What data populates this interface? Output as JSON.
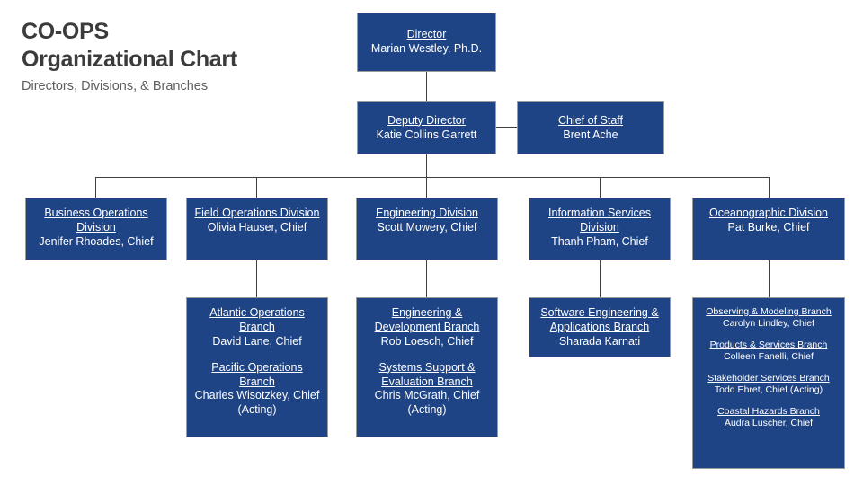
{
  "header": {
    "title_line1": "CO-OPS",
    "title_line2": "Organizational Chart",
    "subtitle": "Directors, Divisions, & Branches"
  },
  "colors": {
    "node_fill": "#1f4485",
    "node_border": "#9a9a9a",
    "node_text": "#ffffff",
    "connector": "#3f3f3f",
    "title_text": "#3b3b3b",
    "subtitle_text": "#5e5e5e",
    "background": "#ffffff"
  },
  "nodes": {
    "director": {
      "title": "Director",
      "name": "Marian Westley, Ph.D."
    },
    "deputy_director": {
      "title": "Deputy Director",
      "name": "Katie Collins Garrett"
    },
    "chief_of_staff": {
      "title": "Chief of Staff",
      "name": "Brent Ache"
    }
  },
  "divisions": [
    {
      "title": "Business Operations Division",
      "name": "Jenifer Rhoades, Chief"
    },
    {
      "title": "Field Operations Division",
      "name": "Olivia Hauser, Chief"
    },
    {
      "title": "Engineering Division",
      "name": "Scott Mowery, Chief"
    },
    {
      "title": "Information Services Division",
      "name": "Thanh Pham, Chief"
    },
    {
      "title": "Oceanographic Division",
      "name": "Pat Burke, Chief"
    }
  ],
  "branch_groups": {
    "field_operations": [
      {
        "title": "Atlantic Operations Branch",
        "name": "David Lane, Chief"
      },
      {
        "title": "Pacific Operations Branch",
        "name": "Charles Wisotzkey, Chief (Acting)"
      }
    ],
    "engineering": [
      {
        "title": "Engineering & Development Branch",
        "name": "Rob Loesch, Chief"
      },
      {
        "title": "Systems Support & Evaluation Branch",
        "name": "Chris McGrath, Chief (Acting)"
      }
    ],
    "information_services": [
      {
        "title": "Software Engineering & Applications Branch",
        "name": "Sharada Karnati"
      }
    ],
    "oceanographic": [
      {
        "title": "Observing & Modeling Branch",
        "name": "Carolyn Lindley, Chief"
      },
      {
        "title": "Products & Services Branch",
        "name": "Colleen Fanelli, Chief"
      },
      {
        "title": "Stakeholder Services Branch",
        "name": "Todd Ehret, Chief (Acting)"
      },
      {
        "title": "Coastal Hazards Branch",
        "name": "Audra Luscher, Chief"
      }
    ]
  }
}
